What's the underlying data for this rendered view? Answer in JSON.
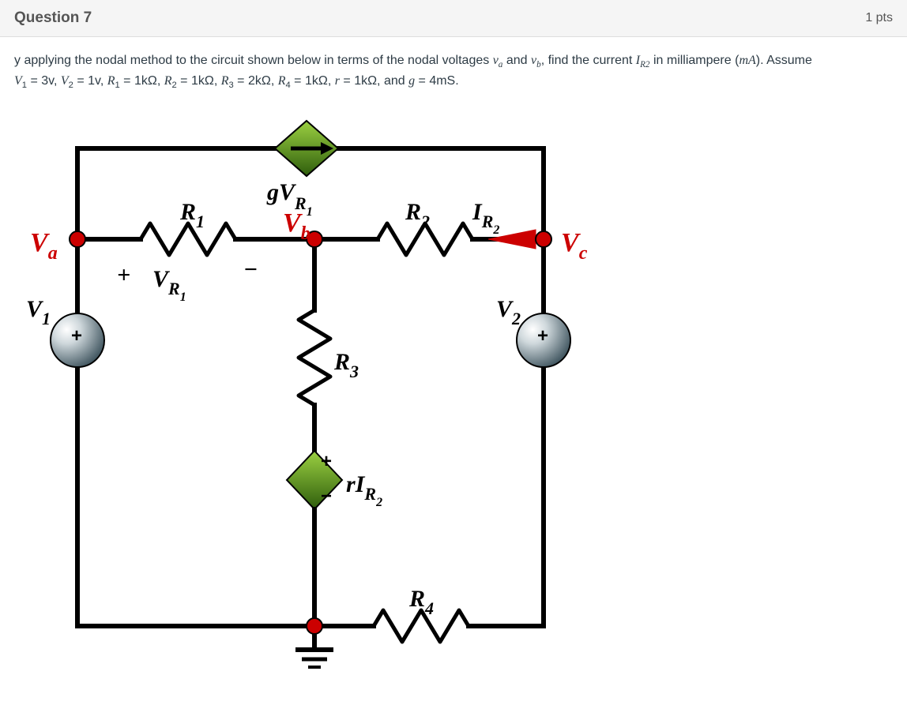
{
  "header": {
    "title": "Question 7",
    "points": "1 pts"
  },
  "prompt": {
    "line1_pre": "y applying the nodal method to the circuit shown below in terms of the nodal voltages ",
    "va": "v",
    "va_sub": "a",
    "and1": " and ",
    "vb": "v",
    "vb_sub": "b",
    "line1_mid": ", find the current ",
    "ir2": "I",
    "ir2_sub": "R2",
    "line1_end": " in milliampere (",
    "mA": "mA",
    "line1_close": "). Assume",
    "line2_v1": "V",
    "line2_v1sub": "1",
    "eq1": " = 3v, ",
    "line2_v2": "V",
    "line2_v2sub": "2",
    "eq2": " = 1v, ",
    "line2_r1": "R",
    "line2_r1sub": "1",
    "eq3": " = 1kΩ, ",
    "line2_r2": "R",
    "line2_r2sub": "2",
    "eq4": " = 1kΩ, ",
    "line2_r3": "R",
    "line2_r3sub": "3",
    "eq5": " = 2kΩ, ",
    "line2_r4": "R",
    "line2_r4sub": "4",
    "eq6": " = 1kΩ, ",
    "line2_r": "r",
    "eq7": " = 1kΩ, and ",
    "line2_g": "g",
    "eq8": " = 4mS."
  },
  "diagram": {
    "Va": "V",
    "Va_sub": "a",
    "Vb": "V",
    "Vb_sub": "b",
    "Vc": "V",
    "Vc_sub": "c",
    "V1": "V",
    "V1_sub": "1",
    "V2": "V",
    "V2_sub": "2",
    "R1": "R",
    "R1_sub": "1",
    "R2": "R",
    "R2_sub": "2",
    "R3": "R",
    "R3_sub": "3",
    "R4": "R",
    "R4_sub": "4",
    "VR1_plus": "+",
    "VR1": "V",
    "VR1_R": "R",
    "VR1_sub": "1",
    "VR1_minus": "−",
    "gVR1_g": "g",
    "gVR1_V": "V",
    "gVR1_R": "R",
    "gVR1_sub": "1",
    "IR2_I": "I",
    "IR2_R": "R",
    "IR2_sub": "2",
    "rIR2_r": "r",
    "rIR2_I": "I",
    "rIR2_R": "R",
    "rIR2_sub": "2",
    "plus1": "+",
    "plus2": "+",
    "plus_d": "+",
    "minus_d": "−"
  }
}
